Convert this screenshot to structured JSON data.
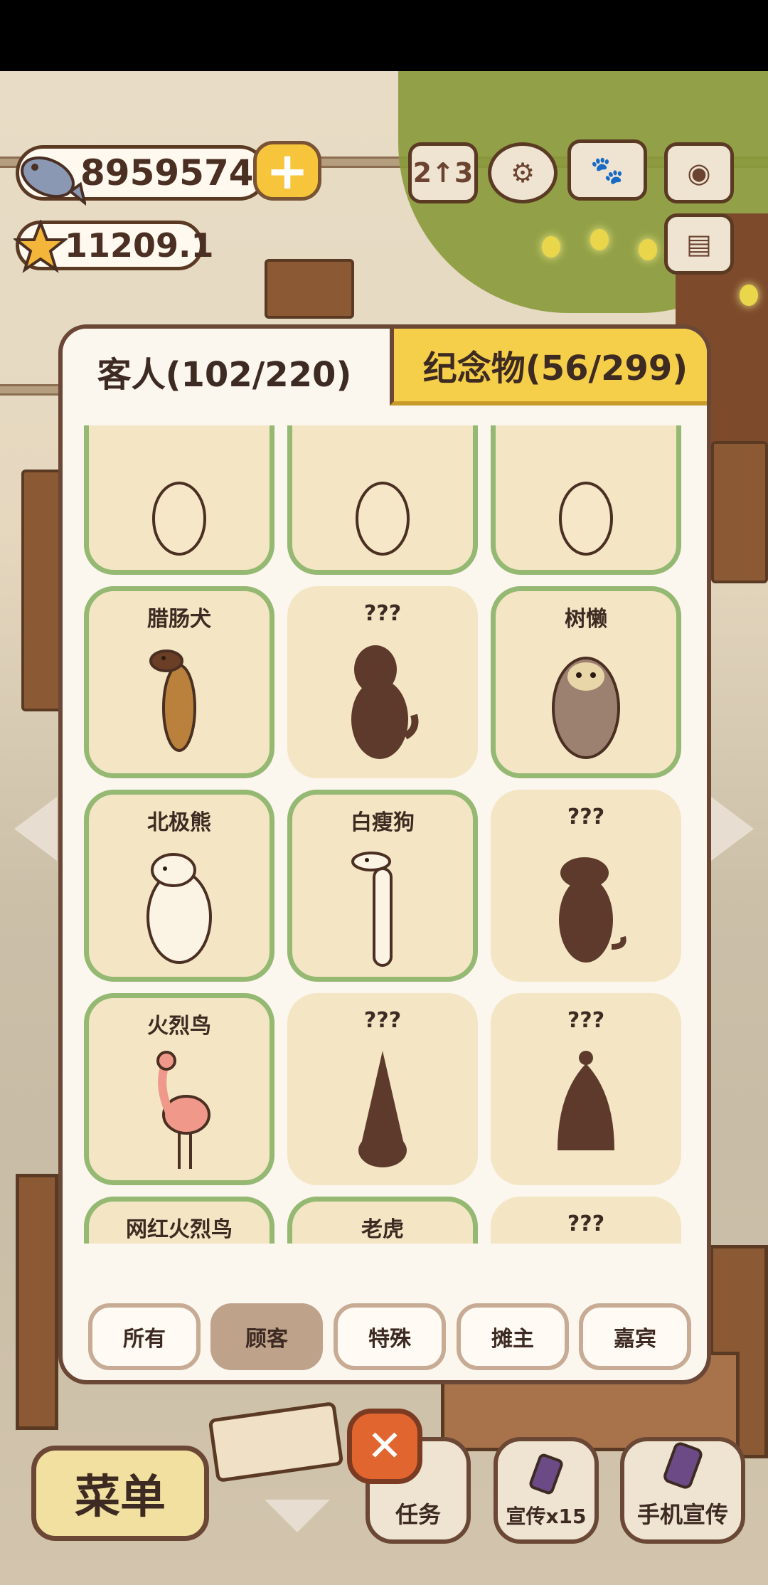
{
  "hud": {
    "fish_count": "8959574",
    "star_count": "11209.1",
    "plus_label": "+",
    "top_icons": [
      "ranking-icon",
      "settings-gear-icon",
      "paw-book-icon",
      "camera-icon",
      "notice-board-icon"
    ]
  },
  "modal": {
    "tab_guests": "客人(102/220)",
    "tab_souvenirs": "纪念物(56/299)",
    "cards": [
      {
        "name": "",
        "state": "found"
      },
      {
        "name": "",
        "state": "found"
      },
      {
        "name": "",
        "state": "found"
      },
      {
        "name": "腊肠犬",
        "state": "found"
      },
      {
        "name": "???",
        "state": "unknown"
      },
      {
        "name": "树懒",
        "state": "found"
      },
      {
        "name": "北极熊",
        "state": "found"
      },
      {
        "name": "白瘦狗",
        "state": "found"
      },
      {
        "name": "???",
        "state": "unknown"
      },
      {
        "name": "火烈鸟",
        "state": "found"
      },
      {
        "name": "???",
        "state": "unknown"
      },
      {
        "name": "???",
        "state": "unknown"
      },
      {
        "name": "网红火烈鸟",
        "state": "found"
      },
      {
        "name": "老虎",
        "state": "found"
      },
      {
        "name": "???",
        "state": "unknown"
      }
    ],
    "filters": {
      "all": "所有",
      "customer": "顾客",
      "special": "特殊",
      "vendor": "摊主",
      "guest": "嘉宾",
      "active": "customer"
    }
  },
  "bottom": {
    "menu_label": "菜单",
    "close_label": "✕",
    "task_label": "任务",
    "promo_label": "宣传x15",
    "phone_promo_label": "手机宣传"
  },
  "colors": {
    "found_border": "#95b872",
    "card_bg": "#f4e6c4",
    "silhouette": "#5e3a2c",
    "active_filter": "#bfa28a",
    "souvenir_tab": "#f6cf4a"
  }
}
